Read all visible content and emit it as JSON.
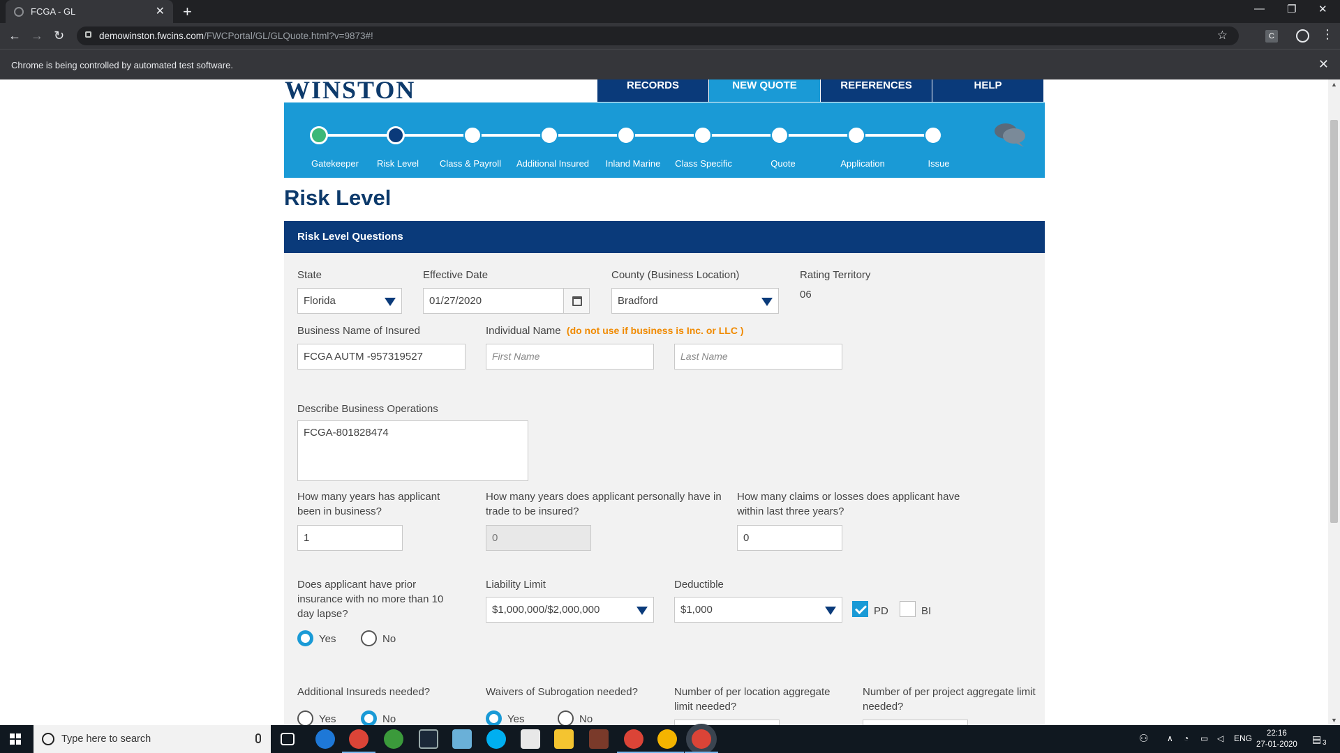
{
  "browser": {
    "tab_title": "FCGA - GL",
    "url_host": "demowinston.fwcins.com",
    "url_path": "/FWCPortal/GL/GLQuote.html?v=9873#!",
    "infobar": "Chrome is being controlled by automated test software."
  },
  "site": {
    "logo": "WINSTON",
    "nav": [
      "RECORDS",
      "NEW QUOTE",
      "REFERENCES",
      "HELP"
    ],
    "active_nav": "NEW QUOTE"
  },
  "steps": [
    {
      "label": "Gatekeeper",
      "state": "done"
    },
    {
      "label": "Risk Level",
      "state": "current"
    },
    {
      "label": "Class & Payroll",
      "state": "todo"
    },
    {
      "label": "Additional Insured",
      "state": "todo"
    },
    {
      "label": "Inland Marine",
      "state": "todo"
    },
    {
      "label": "Class Specific",
      "state": "todo"
    },
    {
      "label": "Quote",
      "state": "todo"
    },
    {
      "label": "Application",
      "state": "todo"
    },
    {
      "label": "Issue",
      "state": "todo"
    }
  ],
  "page": {
    "title": "Risk Level",
    "panel_title": "Risk Level Questions"
  },
  "form": {
    "state_label": "State",
    "state_value": "Florida",
    "effective_date_label": "Effective Date",
    "effective_date_value": "01/27/2020",
    "county_label": "County (Business Location)",
    "county_value": "Bradford",
    "rating_territory_label": "Rating Territory",
    "rating_territory_value": "06",
    "business_name_label": "Business Name of Insured",
    "business_name_value": "FCGA AUTM -957319527",
    "individual_name_label": "Individual Name",
    "individual_name_warning": "(do not use if business is Inc. or LLC )",
    "first_name_placeholder": "First Name",
    "last_name_placeholder": "Last Name",
    "describe_ops_label": "Describe Business Operations",
    "describe_ops_value": "FCGA-801828474",
    "years_in_business_label": "How many years has applicant been in business?",
    "years_in_business_value": "1",
    "years_in_trade_label": "How many years does applicant personally have in trade to be insured?",
    "years_in_trade_value": "0",
    "claims_label": "How many claims or losses does applicant have within last three years?",
    "claims_value": "0",
    "prior_insurance_label": "Does applicant have prior insurance with no more than 10 day lapse?",
    "prior_insurance_yes": "Yes",
    "prior_insurance_no": "No",
    "liability_limit_label": "Liability Limit",
    "liability_limit_value": "$1,000,000/$2,000,000",
    "deductible_label": "Deductible",
    "deductible_value": "$1,000",
    "pd_label": "PD",
    "pd_checked": true,
    "bi_label": "BI",
    "bi_checked": false,
    "additional_insureds_label": "Additional Insureds needed?",
    "additional_insureds_yes": "Yes",
    "additional_insureds_no": "No",
    "waivers_label": "Waivers of Subrogation needed?",
    "waivers_yes": "Yes",
    "waivers_no": "No",
    "per_location_label": "Number of per location aggregate limit needed?",
    "per_project_label": "Number of per project aggregate limit needed?"
  },
  "taskbar": {
    "search_placeholder": "Type here to search",
    "lang": "ENG",
    "time": "22:16",
    "date": "27-01-2020",
    "notif_count": "3"
  },
  "colors": {
    "brand_navy": "#0a3a7a",
    "brand_blue": "#1a9ad6",
    "step_done": "#3cb878",
    "warning": "#f08a00"
  }
}
